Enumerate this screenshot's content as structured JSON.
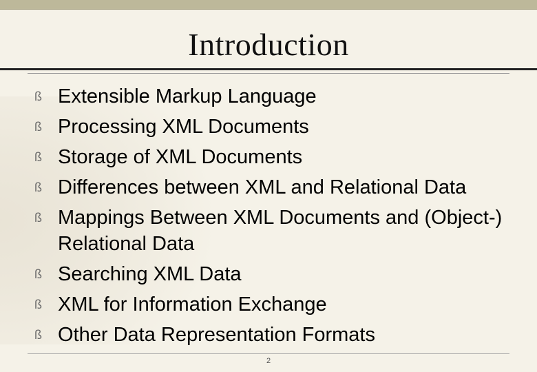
{
  "slide": {
    "title": "Introduction",
    "bullets": [
      "Extensible Markup Language",
      "Processing XML Documents",
      "Storage of XML Documents",
      "Differences between XML and Relational Data",
      "Mappings Between XML Documents and (Object-) Relational Data",
      "Searching XML Data",
      "XML for Information Exchange",
      "Other Data Representation Formats"
    ],
    "bullet_glyph": "ß",
    "page_number": "2"
  },
  "colors": {
    "top_bar": "#bdb89a",
    "background": "#f5f2e8"
  }
}
